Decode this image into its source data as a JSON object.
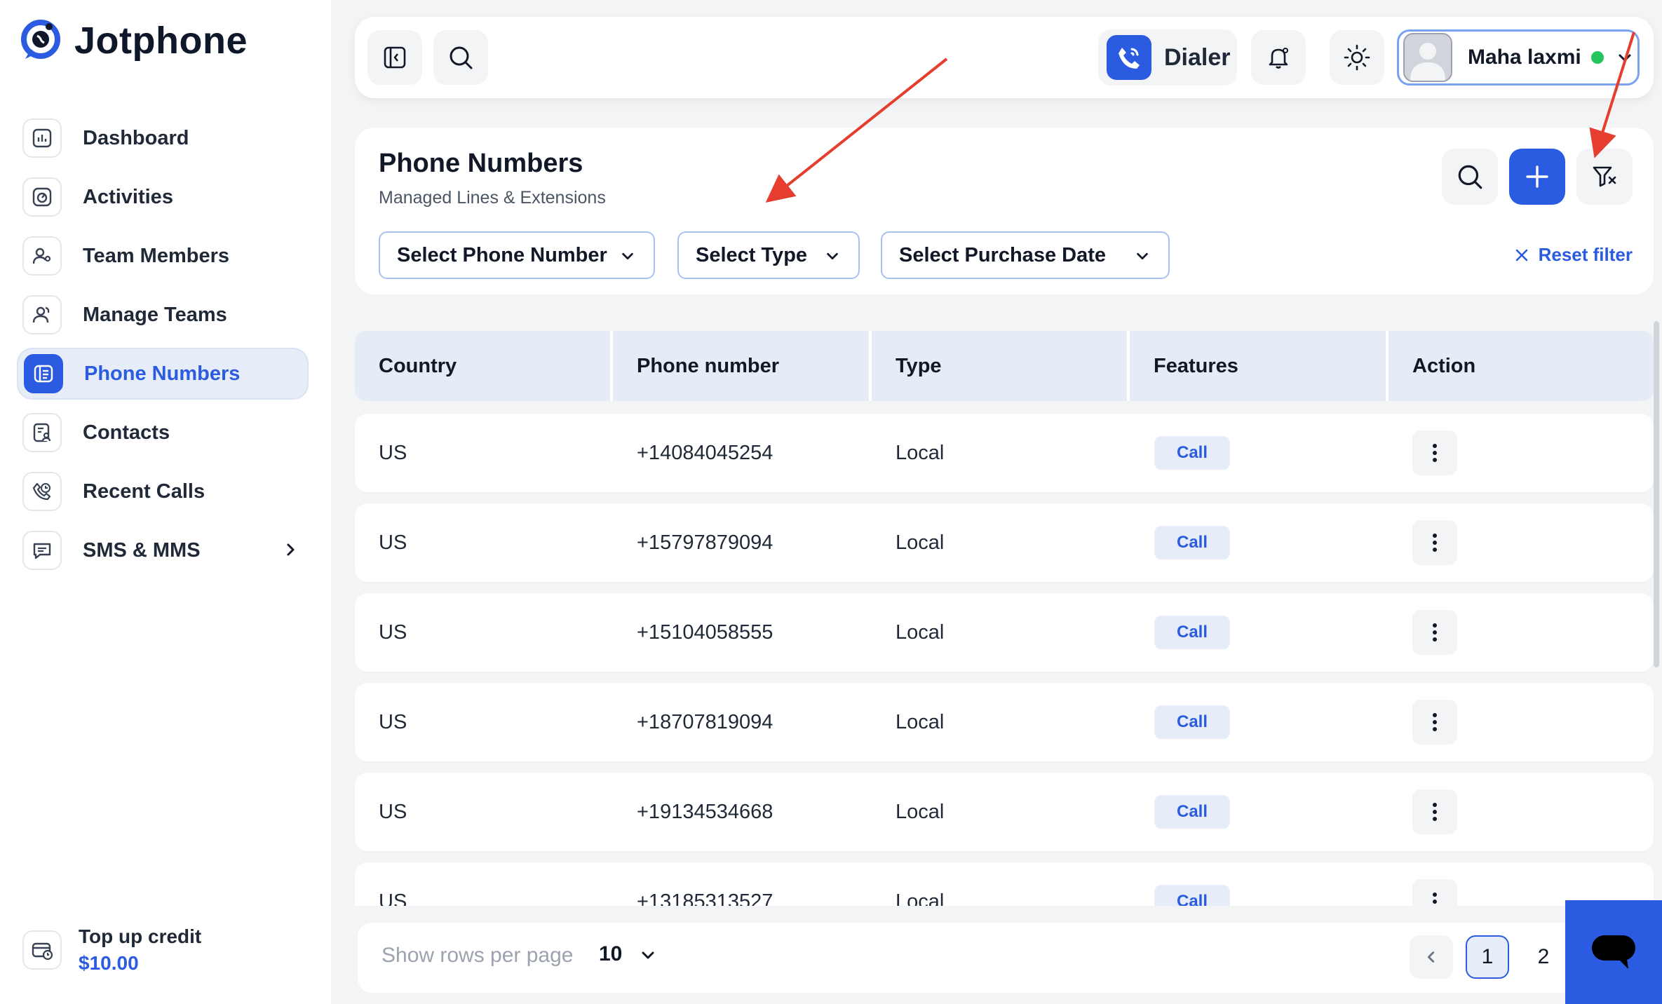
{
  "app": {
    "name": "Jotphone"
  },
  "sidebar": {
    "items": [
      {
        "label": "Dashboard",
        "icon": "dashboard-icon",
        "active": false
      },
      {
        "label": "Activities",
        "icon": "activities-icon",
        "active": false
      },
      {
        "label": "Team Members",
        "icon": "team-members-icon",
        "active": false
      },
      {
        "label": "Manage Teams",
        "icon": "manage-teams-icon",
        "active": false
      },
      {
        "label": "Phone Numbers",
        "icon": "phone-numbers-icon",
        "active": true
      },
      {
        "label": "Contacts",
        "icon": "contacts-icon",
        "active": false
      },
      {
        "label": "Recent Calls",
        "icon": "recent-calls-icon",
        "active": false
      },
      {
        "label": "SMS & MMS",
        "icon": "sms-icon",
        "active": false,
        "has_submenu": true
      }
    ],
    "credit": {
      "label": "Top up credit",
      "amount": "$10.00"
    }
  },
  "topbar": {
    "dialer_label": "Dialer",
    "user_name": "Maha laxmi",
    "user_status": "online"
  },
  "page": {
    "title": "Phone Numbers",
    "subtitle": "Managed Lines & Extensions",
    "filters": {
      "phone_number": "Select Phone Number",
      "type": "Select Type",
      "purchase_date": "Select Purchase Date"
    },
    "reset_label": "Reset filter"
  },
  "table": {
    "columns": [
      "Country",
      "Phone number",
      "Type",
      "Features",
      "Action"
    ],
    "rows": [
      {
        "country": "US",
        "phone": "+14084045254",
        "type": "Local",
        "feature": "Call"
      },
      {
        "country": "US",
        "phone": "+15797879094",
        "type": "Local",
        "feature": "Call"
      },
      {
        "country": "US",
        "phone": "+15104058555",
        "type": "Local",
        "feature": "Call"
      },
      {
        "country": "US",
        "phone": "+18707819094",
        "type": "Local",
        "feature": "Call"
      },
      {
        "country": "US",
        "phone": "+19134534668",
        "type": "Local",
        "feature": "Call"
      },
      {
        "country": "US",
        "phone": "+13185313527",
        "type": "Local",
        "feature": "Call"
      }
    ]
  },
  "pagination": {
    "rows_label": "Show rows per page",
    "rows_value": "10",
    "pages": [
      "1",
      "2"
    ],
    "current_page": "1"
  },
  "colors": {
    "accent": "#2b5be0",
    "annotation_arrow": "#e53e2e",
    "status_online": "#22c55e"
  }
}
